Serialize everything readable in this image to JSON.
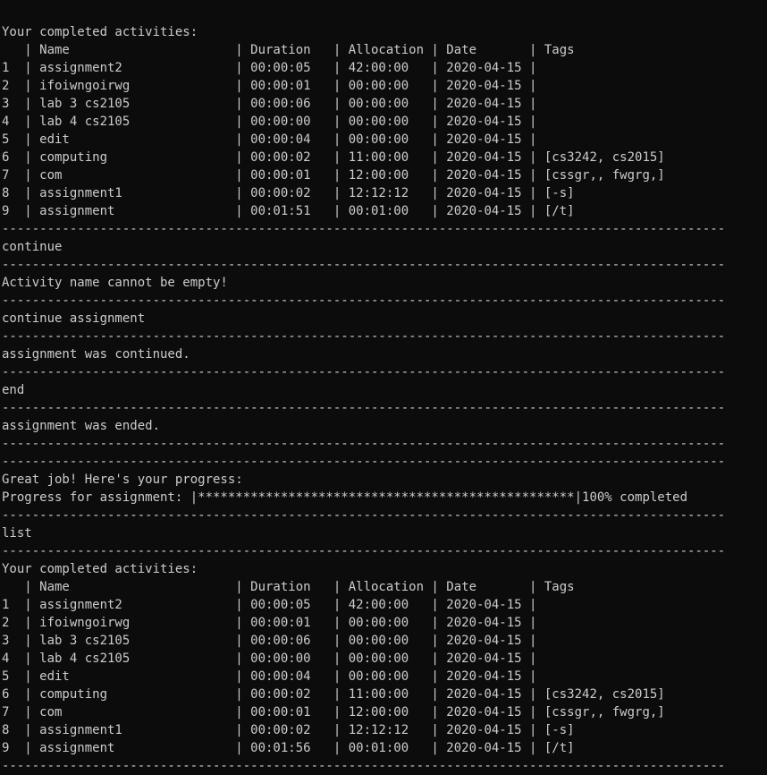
{
  "terminal": {
    "lines": [
      "Your completed activities:",
      "   | Name                      | Duration   | Allocation | Date       | Tags",
      "1  | assignment2               | 00:00:05   | 42:00:00   | 2020-04-15 |",
      "2  | ifoiwngoirwg              | 00:00:01   | 00:00:00   | 2020-04-15 |",
      "3  | lab 3 cs2105              | 00:00:06   | 00:00:00   | 2020-04-15 |",
      "4  | lab 4 cs2105              | 00:00:00   | 00:00:00   | 2020-04-15 |",
      "5  | edit                      | 00:00:04   | 00:00:00   | 2020-04-15 |",
      "6  | computing                 | 00:00:02   | 11:00:00   | 2020-04-15 | [cs3242, cs2015]",
      "7  | com                       | 00:00:01   | 12:00:00   | 2020-04-15 | [cssgr,, fwgrg,]",
      "8  | assignment1               | 00:00:02   | 12:12:12   | 2020-04-15 | [-s]",
      "9  | assignment                | 00:01:51   | 00:01:00   | 2020-04-15 | [/t]",
      "------------------------------------------------------------------------------------------------",
      "continue",
      "------------------------------------------------------------------------------------------------",
      "Activity name cannot be empty!",
      "------------------------------------------------------------------------------------------------",
      "continue assignment",
      "------------------------------------------------------------------------------------------------",
      "assignment was continued.",
      "------------------------------------------------------------------------------------------------",
      "end",
      "------------------------------------------------------------------------------------------------",
      "assignment was ended.",
      "------------------------------------------------------------------------------------------------",
      "------------------------------------------------------------------------------------------------",
      "Great job! Here's your progress:",
      "Progress for assignment: |**************************************************|100% completed",
      "------------------------------------------------------------------------------------------------",
      "list",
      "------------------------------------------------------------------------------------------------",
      "Your completed activities:",
      "   | Name                      | Duration   | Allocation | Date       | Tags",
      "1  | assignment2               | 00:00:05   | 42:00:00   | 2020-04-15 |",
      "2  | ifoiwngoirwg              | 00:00:01   | 00:00:00   | 2020-04-15 |",
      "3  | lab 3 cs2105              | 00:00:06   | 00:00:00   | 2020-04-15 |",
      "4  | lab 4 cs2105              | 00:00:00   | 00:00:00   | 2020-04-15 |",
      "5  | edit                      | 00:00:04   | 00:00:00   | 2020-04-15 |",
      "6  | computing                 | 00:00:02   | 11:00:00   | 2020-04-15 | [cs3242, cs2015]",
      "7  | com                       | 00:00:01   | 12:00:00   | 2020-04-15 | [cssgr,, fwgrg,]",
      "8  | assignment1               | 00:00:02   | 12:12:12   | 2020-04-15 | [-s]",
      "9  | assignment                | 00:01:56   | 00:01:00   | 2020-04-15 | [/t]",
      "------------------------------------------------------------------------------------------------"
    ]
  }
}
